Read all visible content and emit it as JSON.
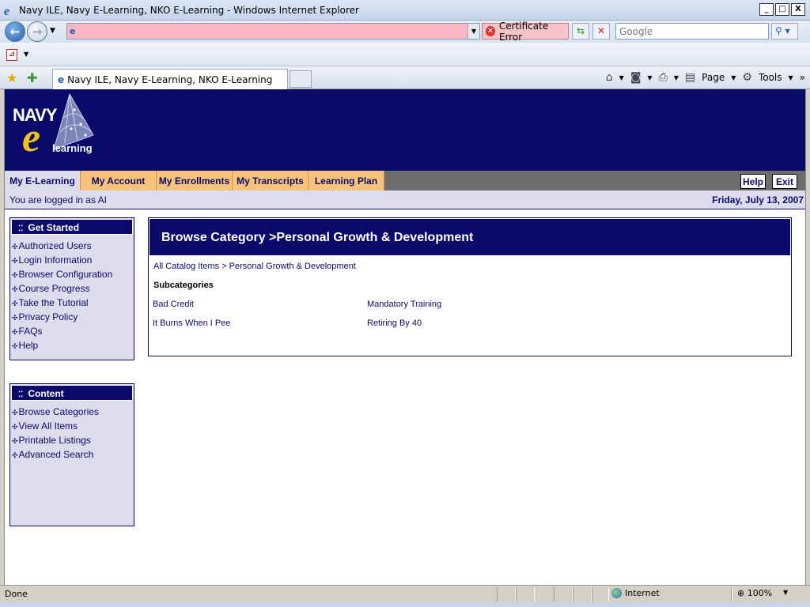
{
  "window": {
    "title": "Navy ILE, Navy E-Learning, NKO E-Learning - Windows Internet Explorer",
    "buttons": [
      "_",
      "□",
      "X"
    ]
  },
  "addressbar": {
    "cert_error": "Certificate Error",
    "search_placeholder": "Google"
  },
  "tabs": {
    "active_title": "Navy ILE, Navy E-Learning, NKO E-Learning"
  },
  "commandbar": {
    "page_label": "Page",
    "tools_label": "Tools"
  },
  "site": {
    "logo": {
      "navy": "NAVY",
      "e": "e",
      "learning": "learning"
    },
    "menu": [
      "My E-Learning",
      "My Account",
      "My Enrollments",
      "My Transcripts",
      "Learning Plan"
    ],
    "help": "Help",
    "exit": "Exit",
    "logged_in": "You are logged in as AI",
    "date": "Friday, July 13, 2007"
  },
  "sidebar": {
    "get_started": {
      "title": "Get Started",
      "items": [
        "Authorized Users",
        "Login Information",
        "Browser Configuration",
        "Course Progress",
        "Take the Tutorial",
        "Privacy Policy",
        "FAQs",
        "Help"
      ]
    },
    "content": {
      "title": "Content",
      "items": [
        "Browse Categories",
        "View All Items",
        "Printable Listings",
        "Advanced Search"
      ]
    }
  },
  "main": {
    "heading": "Browse Category >Personal Growth & Development",
    "breadcrumb": "All Catalog Items > Personal Growth & Development",
    "subcategories_title": "Subcategories",
    "subcategories": [
      "Bad Credit",
      "Mandatory Training",
      "It Burns When I Pee",
      "Retiring By 40"
    ]
  },
  "statusbar": {
    "status": "Done",
    "zone": "Internet",
    "zoom": "100%"
  },
  "colors": {
    "navy": "#0a0a6b",
    "menu_tab": "#f7c27a",
    "menu_active": "#dcdcec",
    "sidebar_bg": "#dcdcec",
    "logo_yellow": "#f2c21b",
    "cert_error_bg": "#f7c3c8"
  }
}
